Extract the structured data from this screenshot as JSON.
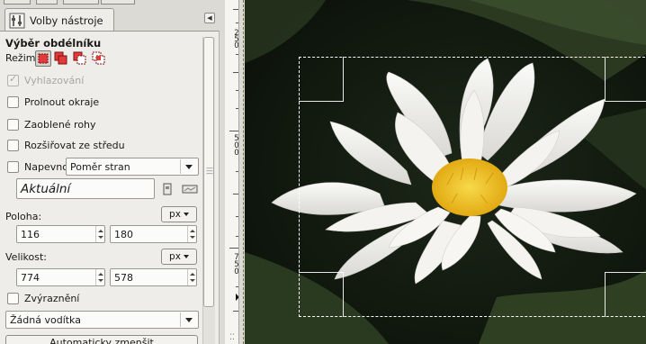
{
  "dock": {
    "tab_label": "Volby nástroje",
    "tab_icon": "tool-options-icon",
    "menu_icon": "dock-menu-arrow-icon",
    "panel_title": "Výběr obdélníku",
    "mode_label": "Režim:",
    "mode_buttons": [
      {
        "name": "replace-mode",
        "active": true
      },
      {
        "name": "add-mode",
        "active": false
      },
      {
        "name": "subtract-mode",
        "active": false
      },
      {
        "name": "intersect-mode",
        "active": false
      }
    ],
    "antialias": {
      "label": "Vyhlazování",
      "checked": true,
      "disabled": true
    },
    "feather": {
      "label": "Prolnout okraje",
      "checked": false
    },
    "rounded": {
      "label": "Zaoblené rohy",
      "checked": false
    },
    "expand_center": {
      "label": "Rozšiřovat ze středu",
      "checked": false
    },
    "fixed": {
      "label": "Napevno:",
      "checked": false,
      "value": "Poměr stran"
    },
    "aspect_value": "Aktuální",
    "position": {
      "label": "Poloha:",
      "unit": "px",
      "x": "116",
      "y": "180"
    },
    "size": {
      "label": "Velikost:",
      "unit": "px",
      "w": "774",
      "h": "578"
    },
    "highlight": {
      "label": "Zvýraznění",
      "checked": false
    },
    "guides": {
      "value": "Žádná vodítka"
    },
    "auto_shrink_label": "Automaticky zmenšit"
  },
  "canvas": {
    "ruler_labels": [
      "2",
      "5",
      "0",
      "5",
      "0",
      "0",
      "7",
      "5",
      "0"
    ],
    "image_subject": "white-water-lily-photo",
    "colors": {
      "petal": "#f4f3f0",
      "center": "#f3c81b",
      "leaf": "#2a3a20",
      "background": "#0e140c",
      "selection": "#ffffff"
    }
  }
}
